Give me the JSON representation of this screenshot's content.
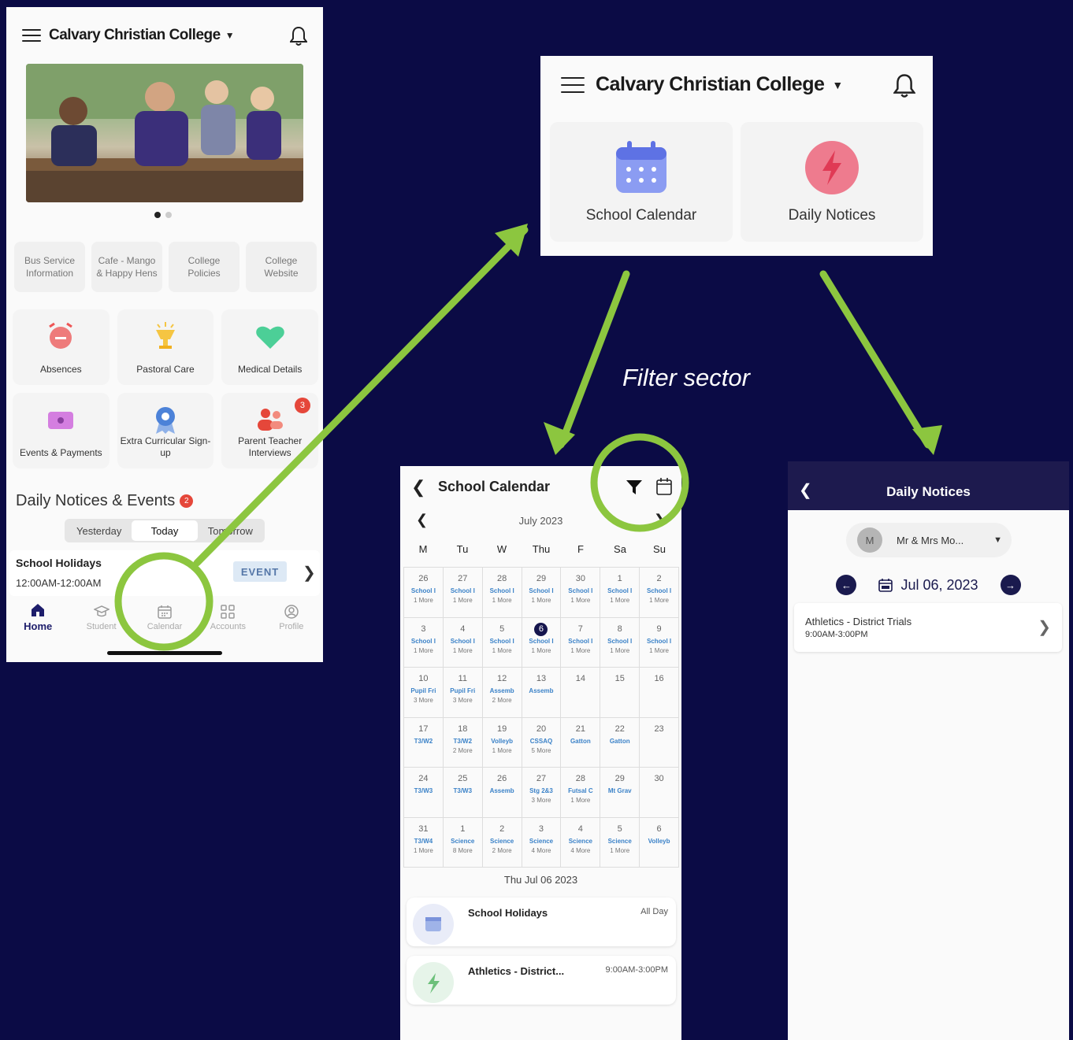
{
  "app": {
    "school_name": "Calvary Christian College"
  },
  "home": {
    "quick_links": [
      "Bus Service Information",
      "Cafe - Mango & Happy Hens",
      "College Policies",
      "College Website"
    ],
    "tiles": [
      {
        "label": "Absences",
        "icon": "alarm-clock-icon"
      },
      {
        "label": "Pastoral Care",
        "icon": "trophy-icon"
      },
      {
        "label": "Medical Details",
        "icon": "heart-icon"
      },
      {
        "label": "Events & Payments",
        "icon": "ticket-icon"
      },
      {
        "label": "Extra Curricular Sign-up",
        "icon": "ribbon-badge-icon"
      },
      {
        "label": "Parent Teacher Interviews",
        "icon": "people-icon",
        "badge": "3"
      }
    ],
    "section_title": "Daily Notices & Events",
    "section_badge": "2",
    "segments": [
      "Yesterday",
      "Today",
      "Tomorrow"
    ],
    "active_segment": "Today",
    "event": {
      "title": "School Holidays",
      "time": "12:00AM-12:00AM",
      "tag": "EVENT"
    },
    "tabs": [
      "Home",
      "Student",
      "Calendar",
      "Accounts",
      "Profile"
    ],
    "active_tab": "Home"
  },
  "quick_panel": {
    "tiles": [
      {
        "label": "School Calendar",
        "icon": "calendar-icon",
        "color": "#7b8ff0"
      },
      {
        "label": "Daily Notices",
        "icon": "lightning-icon",
        "color": "#ee7b8e"
      }
    ]
  },
  "annotation": {
    "filter_label": "Filter sector"
  },
  "calendar": {
    "title": "School Calendar",
    "month": "July 2023",
    "weekdays": [
      "M",
      "Tu",
      "W",
      "Thu",
      "F",
      "Sa",
      "Su"
    ],
    "days": [
      {
        "d": "26",
        "e": "School I",
        "m": "1 More"
      },
      {
        "d": "27",
        "e": "School I",
        "m": "1 More"
      },
      {
        "d": "28",
        "e": "School I",
        "m": "1 More"
      },
      {
        "d": "29",
        "e": "School I",
        "m": "1 More"
      },
      {
        "d": "30",
        "e": "School I",
        "m": "1 More"
      },
      {
        "d": "1",
        "e": "School I",
        "m": "1 More"
      },
      {
        "d": "2",
        "e": "School I",
        "m": "1 More"
      },
      {
        "d": "3",
        "e": "School I",
        "m": "1 More"
      },
      {
        "d": "4",
        "e": "School I",
        "m": "1 More"
      },
      {
        "d": "5",
        "e": "School I",
        "m": "1 More"
      },
      {
        "d": "6",
        "e": "School I",
        "m": "1 More",
        "sel": true
      },
      {
        "d": "7",
        "e": "School I",
        "m": "1 More"
      },
      {
        "d": "8",
        "e": "School I",
        "m": "1 More"
      },
      {
        "d": "9",
        "e": "School I",
        "m": "1 More"
      },
      {
        "d": "10",
        "e": "Pupil Fri",
        "m": "3 More"
      },
      {
        "d": "11",
        "e": "Pupil Fri",
        "m": "3 More"
      },
      {
        "d": "12",
        "e": "Assemb",
        "m": "2 More"
      },
      {
        "d": "13",
        "e": "Assemb",
        "m": ""
      },
      {
        "d": "14",
        "e": "",
        "m": ""
      },
      {
        "d": "15",
        "e": "",
        "m": ""
      },
      {
        "d": "16",
        "e": "",
        "m": ""
      },
      {
        "d": "17",
        "e": "T3/W2",
        "m": ""
      },
      {
        "d": "18",
        "e": "T3/W2",
        "m": "2 More"
      },
      {
        "d": "19",
        "e": "Volleyb",
        "m": "1 More"
      },
      {
        "d": "20",
        "e": "CSSAQ",
        "m": "5 More"
      },
      {
        "d": "21",
        "e": "Gatton",
        "m": ""
      },
      {
        "d": "22",
        "e": "Gatton",
        "m": ""
      },
      {
        "d": "23",
        "e": "",
        "m": ""
      },
      {
        "d": "24",
        "e": "T3/W3",
        "m": ""
      },
      {
        "d": "25",
        "e": "T3/W3",
        "m": ""
      },
      {
        "d": "26",
        "e": "Assemb",
        "m": ""
      },
      {
        "d": "27",
        "e": "Stg 2&3",
        "m": "3 More"
      },
      {
        "d": "28",
        "e": "Futsal C",
        "m": "1 More"
      },
      {
        "d": "29",
        "e": "Mt Grav",
        "m": ""
      },
      {
        "d": "30",
        "e": "",
        "m": ""
      },
      {
        "d": "31",
        "e": "T3/W4",
        "m": "1 More"
      },
      {
        "d": "1",
        "e": "Science",
        "m": "8 More"
      },
      {
        "d": "2",
        "e": "Science",
        "m": "2 More"
      },
      {
        "d": "3",
        "e": "Science",
        "m": "4 More"
      },
      {
        "d": "4",
        "e": "Science",
        "m": "4 More"
      },
      {
        "d": "5",
        "e": "Science",
        "m": "1 More"
      },
      {
        "d": "6",
        "e": "Volleyb",
        "m": ""
      }
    ],
    "selected_date": "Thu Jul 06 2023",
    "events": [
      {
        "title": "School Holidays",
        "time": "All Day",
        "icon": "calendar-icon"
      },
      {
        "title": "Athletics - District...",
        "time": "9:00AM-3:00PM",
        "icon": "lightning-icon"
      }
    ]
  },
  "notices": {
    "title": "Daily Notices",
    "person_initial": "M",
    "person_name": "Mr & Mrs Mo...",
    "date": "Jul 06, 2023",
    "items": [
      {
        "title": "Athletics - District Trials",
        "time": "9:00AM-3:00PM"
      }
    ]
  }
}
